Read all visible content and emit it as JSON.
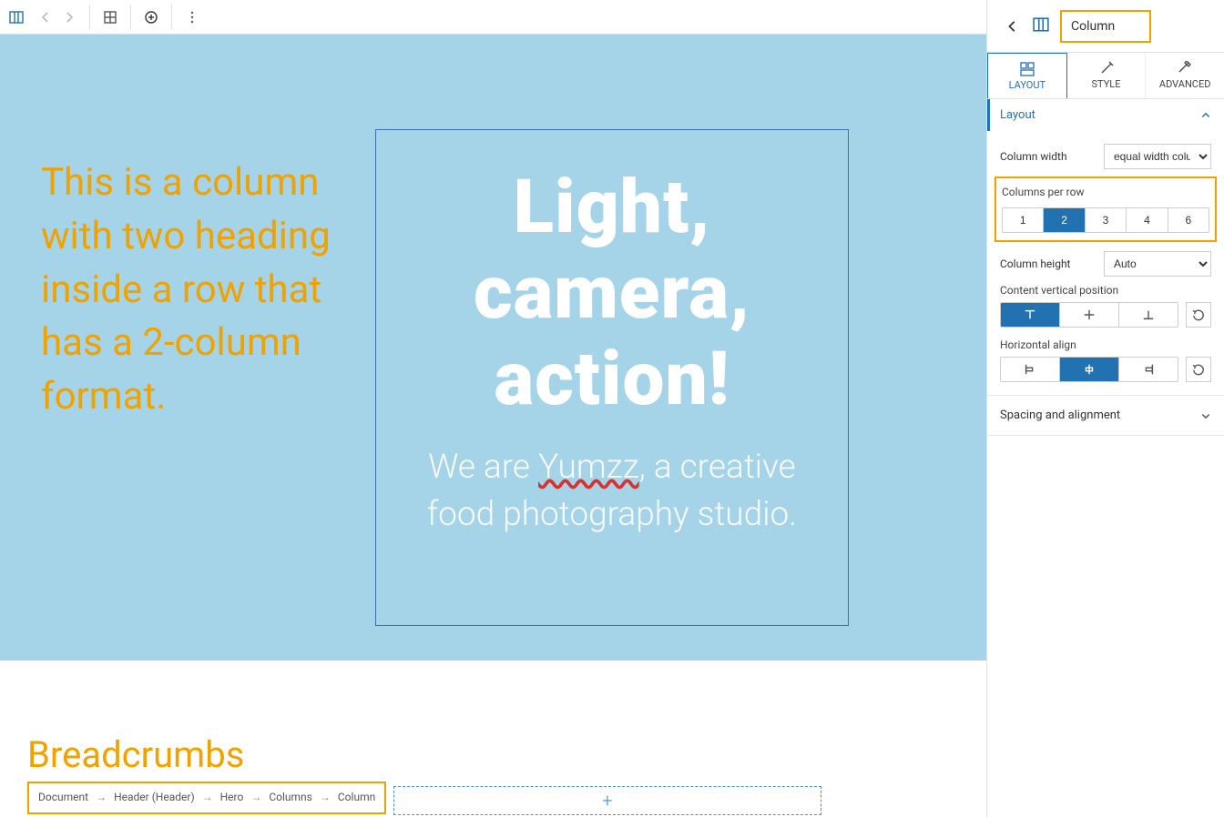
{
  "toolbar": {
    "icons": [
      "columns",
      "chev-left",
      "chev-right",
      "grid",
      "plus-circle",
      "more-v"
    ]
  },
  "canvas": {
    "col_left_heading": "This is a column with two heading inside a row that has a 2-column format.",
    "col_right_heading": "Light, camera, action!",
    "col_right_sub_prefix": "We are ",
    "col_right_sub_spelled": "Yumzz",
    "col_right_sub_suffix": ", a creative food photography studio.",
    "below_label": "Breadcrumbs",
    "breadcrumbs": [
      "Document",
      "Header (Header)",
      "Hero",
      "Columns",
      "Column"
    ],
    "add_placeholder": "+"
  },
  "sidebar": {
    "block_title": "Column",
    "tabs": {
      "layout": "LAYOUT",
      "style": "STYLE",
      "advanced": "ADVANCED"
    },
    "section_layout": "Layout",
    "column_width_label": "Column width",
    "column_width_value": "equal width colu…",
    "columns_per_row_label": "Columns per row",
    "columns_per_row_options": [
      "1",
      "2",
      "3",
      "4",
      "6"
    ],
    "columns_per_row_selected": "2",
    "column_height_label": "Column height",
    "column_height_value": "Auto",
    "cvp_label": "Content vertical position",
    "ha_label": "Horizontal align",
    "section_spacing": "Spacing and alignment"
  }
}
